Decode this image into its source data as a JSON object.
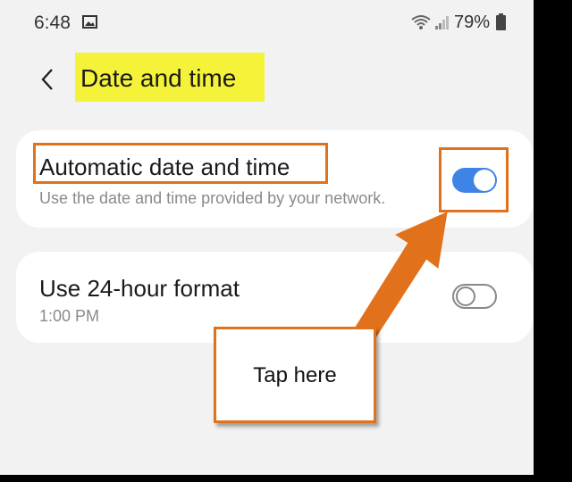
{
  "status_bar": {
    "time": "6:48",
    "battery": "79%",
    "icons": [
      "gallery-icon",
      "wifi-icon",
      "signal-icon",
      "battery-icon"
    ]
  },
  "header": {
    "back_icon": "chevron-left-icon",
    "title": "Date and time"
  },
  "settings": {
    "automatic": {
      "label": "Automatic date and time",
      "description": "Use the date and time provided by your network.",
      "enabled": true
    },
    "format_24h": {
      "label": "Use 24-hour format",
      "description": "1:00 PM",
      "enabled": false
    }
  },
  "callout": {
    "text": "Tap here"
  },
  "colors": {
    "highlight": "#f4f339",
    "annotation": "#e2711c",
    "toggle_on": "#3e84e6",
    "background": "#f2f2f2"
  }
}
